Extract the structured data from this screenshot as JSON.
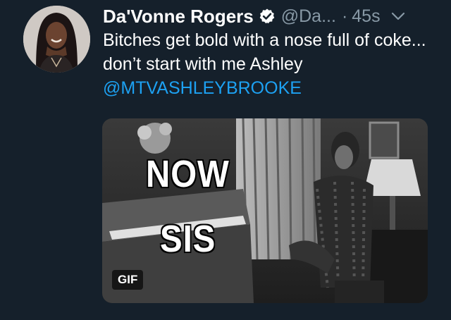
{
  "tweet": {
    "display_name": "Da'Vonne Rogers",
    "handle": "@Da...",
    "separator": "·",
    "timestamp": "45s",
    "text": "Bitches get bold with a nose full of coke... don’t start with me Ashley",
    "mention": "@MTVASHLEYBROOKE",
    "media": {
      "overlay_line1": "NOW",
      "overlay_line2": "SIS",
      "badge": "GIF"
    }
  },
  "colors": {
    "background": "#15202b",
    "text": "#ffffff",
    "secondary": "#8899a6",
    "link": "#1da1f2",
    "verified": "#ffffff"
  },
  "icons": {
    "verified": "verified-badge-icon",
    "more": "chevron-down-icon"
  }
}
